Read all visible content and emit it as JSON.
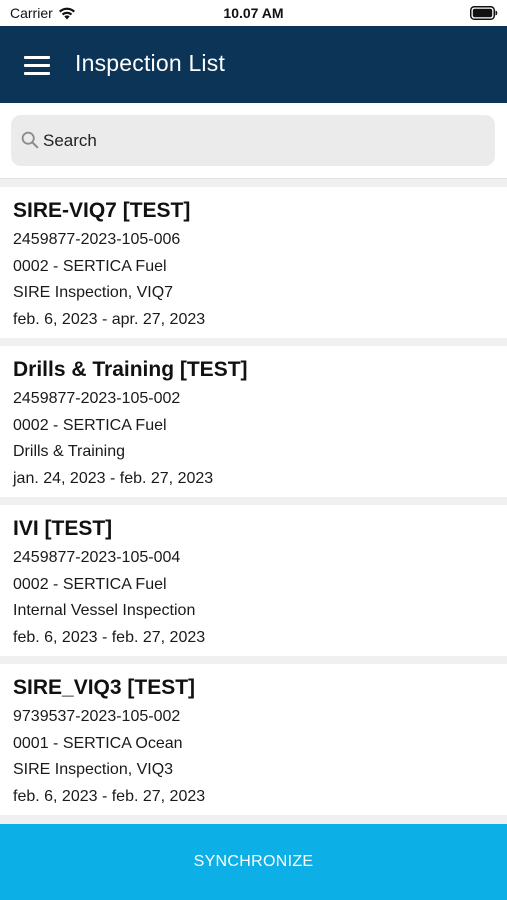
{
  "status_bar": {
    "carrier": "Carrier",
    "time": "10.07 AM"
  },
  "header": {
    "title": "Inspection List",
    "menu_icon": "hamburger-menu-icon"
  },
  "search": {
    "placeholder": "Search",
    "value": "",
    "icon": "search-icon"
  },
  "inspections": [
    {
      "title": "SIRE-VIQ7 [TEST]",
      "number": "2459877-2023-105-006",
      "vessel": "0002 - SERTICA Fuel",
      "type": "SIRE Inspection, VIQ7",
      "dates": "feb. 6, 2023 - apr. 27, 2023"
    },
    {
      "title": "Drills & Training [TEST]",
      "number": "2459877-2023-105-002",
      "vessel": "0002 - SERTICA Fuel",
      "type": "Drills & Training",
      "dates": "jan. 24, 2023 - feb. 27, 2023"
    },
    {
      "title": "IVI [TEST]",
      "number": "2459877-2023-105-004",
      "vessel": "0002 - SERTICA Fuel",
      "type": "Internal Vessel Inspection",
      "dates": "feb. 6, 2023 - feb. 27, 2023"
    },
    {
      "title": "SIRE_VIQ3 [TEST]",
      "number": "9739537-2023-105-002",
      "vessel": "0001 - SERTICA Ocean",
      "type": "SIRE Inspection, VIQ3",
      "dates": "feb. 6, 2023 - feb. 27, 2023"
    }
  ],
  "footer": {
    "sync_label": "SYNCHRONIZE"
  },
  "colors": {
    "header_bg": "#0b3457",
    "sync_bg": "#0cb0e6",
    "page_bg": "#f0f0f0"
  }
}
